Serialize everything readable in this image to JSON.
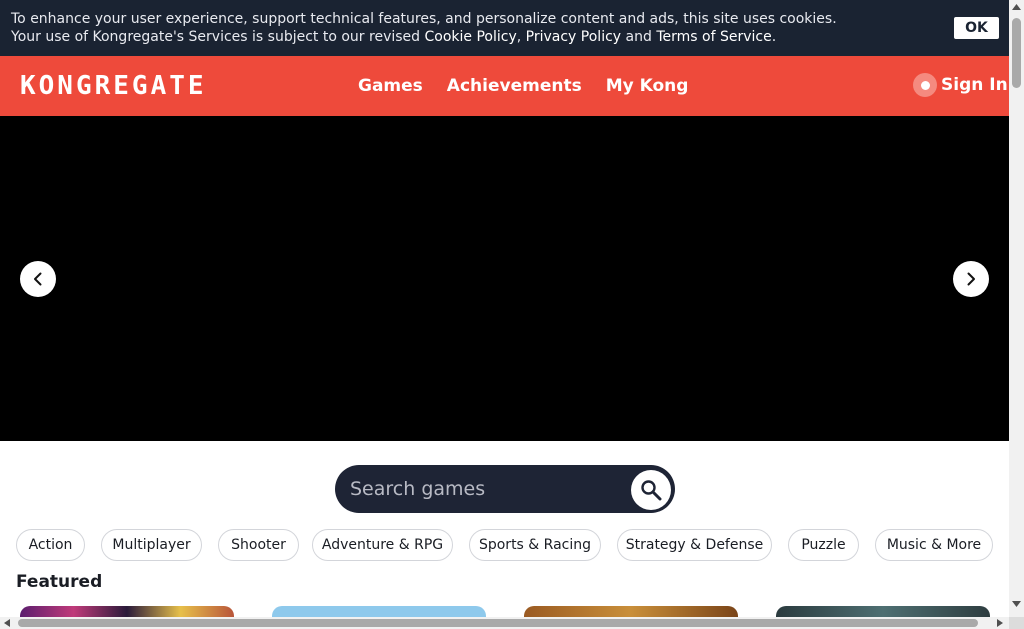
{
  "cookie_banner": {
    "line1": "To enhance your user experience, support technical features, and personalize content and ads, this site uses cookies.",
    "line2_prefix": "Your use of Kongregate's Services is subject to our revised ",
    "cookie_policy": "Cookie Policy",
    "comma": ", ",
    "privacy_policy": "Privacy Policy",
    "and": " and ",
    "terms": "Terms of Service",
    "period": ".",
    "ok_label": "OK"
  },
  "header": {
    "logo": "KONGREGATE",
    "nav": [
      "Games",
      "Achievements",
      "My Kong"
    ],
    "sign_in": "Sign In",
    "accent": "#ee4a3b"
  },
  "hero": {
    "prev_icon": "chevron-left-icon",
    "next_icon": "chevron-right-icon"
  },
  "search": {
    "placeholder": "Search games",
    "icon": "search-icon"
  },
  "categories": [
    "Action",
    "Multiplayer",
    "Shooter",
    "Adventure & RPG",
    "Sports & Racing",
    "Strategy & Defense",
    "Puzzle",
    "Music & More"
  ],
  "featured": {
    "title": "Featured"
  }
}
